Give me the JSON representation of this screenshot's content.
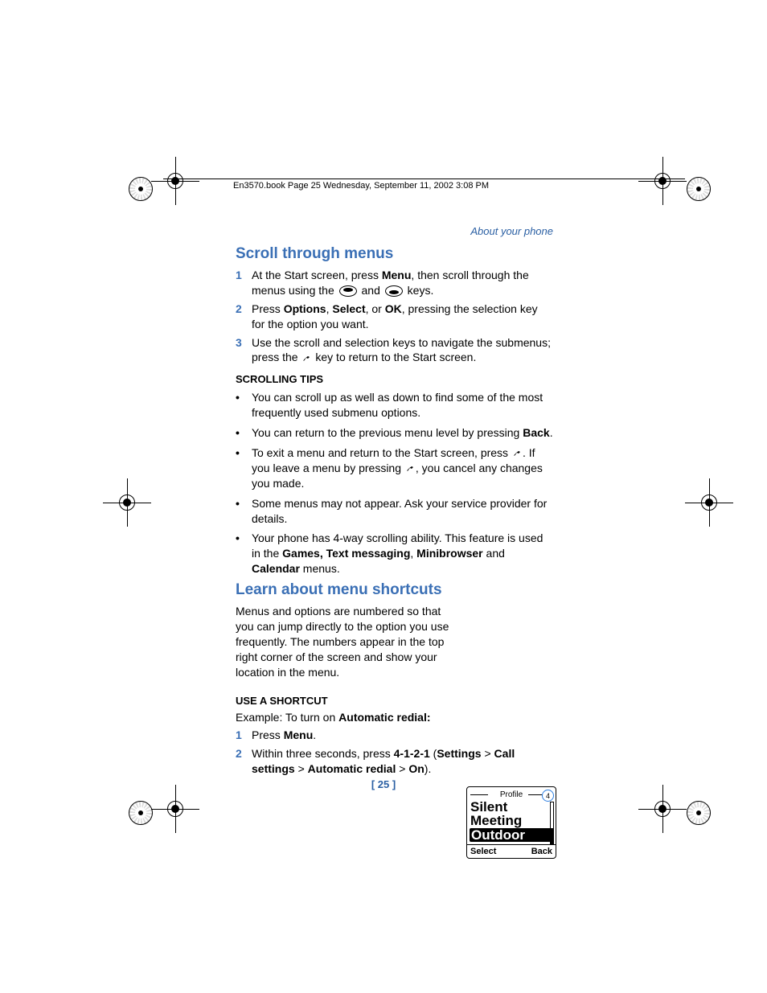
{
  "header_slug": "En3570.book  Page 25  Wednesday, September 11, 2002  3:08 PM",
  "section_label": "About your phone",
  "h_scroll": "Scroll through menus",
  "steps_scroll": [
    {
      "n": "1",
      "pre": "At the Start screen, press ",
      "b1": "Menu",
      "mid": ", then scroll through the menus using the  ",
      "post_and": " and ",
      "post_keys": " keys."
    },
    {
      "n": "2",
      "pre": "Press ",
      "b1": "Options",
      "sep1": ", ",
      "b2": "Select",
      "sep2": ", or ",
      "b3": "OK",
      "post": ", pressing the selection key for the option you want."
    },
    {
      "n": "3",
      "pre": "Use the scroll and selection keys to navigate the submenus; press the ",
      "post": " key to return to the Start screen."
    }
  ],
  "sub_tips": "SCROLLING TIPS",
  "bullets": [
    {
      "text": "You can scroll up as well as down to find some of the most frequently used submenu options."
    },
    {
      "pre": "You can return to the previous menu level by pressing ",
      "b": "Back",
      "post": "."
    },
    {
      "pre": "To exit a menu and return to the Start screen, press ",
      "mid": ". If you leave a menu by pressing ",
      "post": ", you cancel any changes you made."
    },
    {
      "text": "Some menus may not appear. Ask your service provider for details."
    },
    {
      "pre": "Your phone has 4-way scrolling ability. This feature is used in the ",
      "b1": "Games, Text messaging",
      "sep1": ", ",
      "b2": "Minibrowser",
      "sep2": " and ",
      "b3": "Calendar",
      "post": " menus."
    }
  ],
  "h_shortcuts": "Learn about menu shortcuts",
  "para_shortcuts": "Menus and options are numbered so that you can jump directly to the option you use frequently. The numbers appear in the top right corner of the screen and show your location in the menu.",
  "sub_use": "USE A SHORTCUT",
  "example_pre": "Example: To turn on ",
  "example_b": "Automatic redial:",
  "steps_shortcut": [
    {
      "n": "1",
      "pre": "Press ",
      "b": "Menu",
      "post": "."
    },
    {
      "n": "2",
      "pre": "Within three seconds, press ",
      "b1": "4-1-2-1",
      "sep0": " (",
      "b2": "Settings",
      "gt1": " > ",
      "b3": "Call settings",
      "gt2": " > ",
      "b4": "Automatic redial",
      "gt3": " > ",
      "b5": "On",
      "post": ")."
    }
  ],
  "screen": {
    "title": "Profile",
    "num": "4",
    "items": [
      "Silent",
      "Meeting",
      "Outdoor"
    ],
    "selected_index": 2,
    "soft_left": "Select",
    "soft_right": "Back"
  },
  "page_number": "[ 25 ]"
}
